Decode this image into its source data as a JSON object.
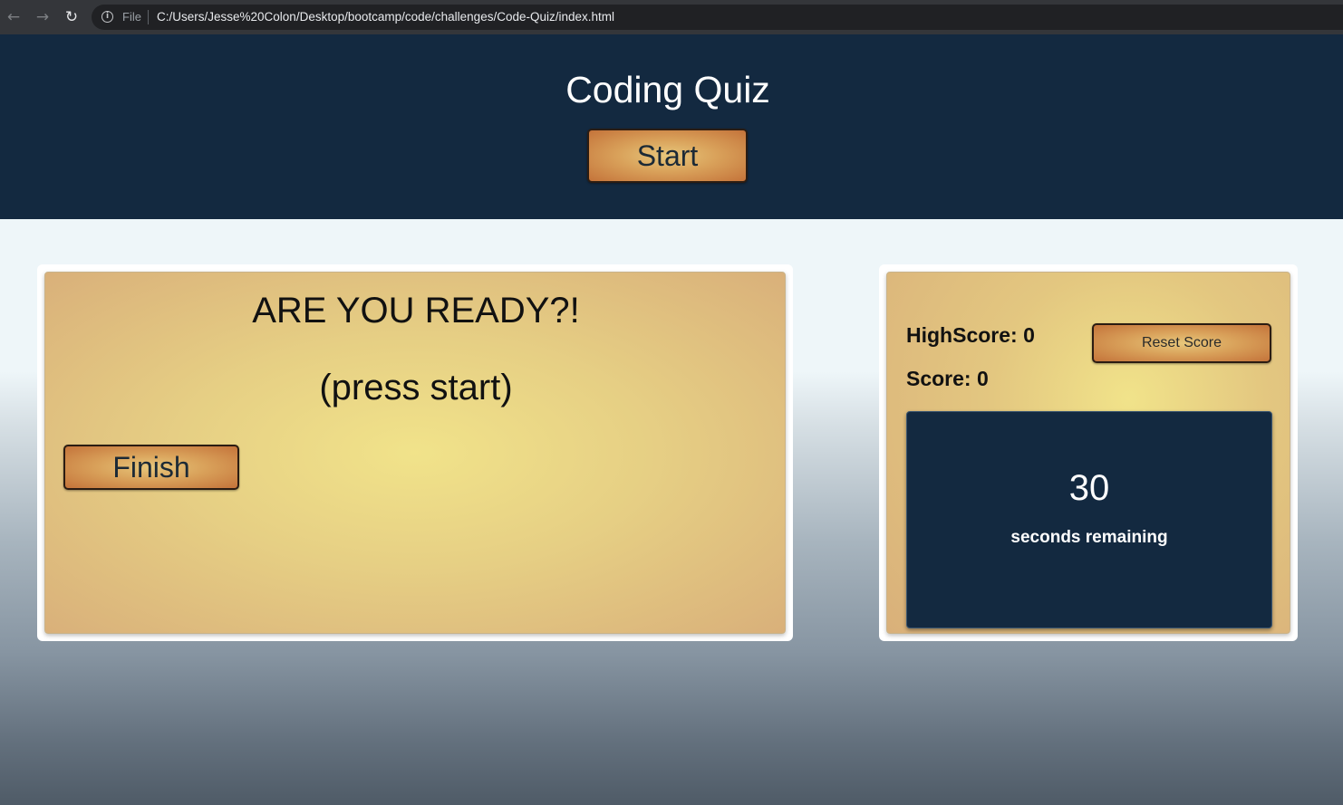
{
  "browser": {
    "back_icon": "arrow-left-icon",
    "forward_icon": "arrow-right-icon",
    "reload_icon": "reload-icon",
    "info_icon": "info-icon",
    "scheme": "File",
    "url": "C:/Users/Jesse%20Colon/Desktop/bootcamp/code/challenges/Code-Quiz/index.html"
  },
  "header": {
    "title": "Coding Quiz",
    "start_label": "Start"
  },
  "quiz": {
    "question": "ARE YOU READY?!",
    "hint": "(press start)",
    "finish_label": "Finish"
  },
  "scoreboard": {
    "highscore": "HighScore: 0",
    "score": "Score: 0",
    "reset_label": "Reset Score",
    "timer_value": "30",
    "timer_label": "seconds remaining"
  },
  "colors": {
    "header_bg": "#132940",
    "timer_bg": "#132940",
    "button_gold": "#d9a15a",
    "card_gold": "#e6cf84"
  }
}
